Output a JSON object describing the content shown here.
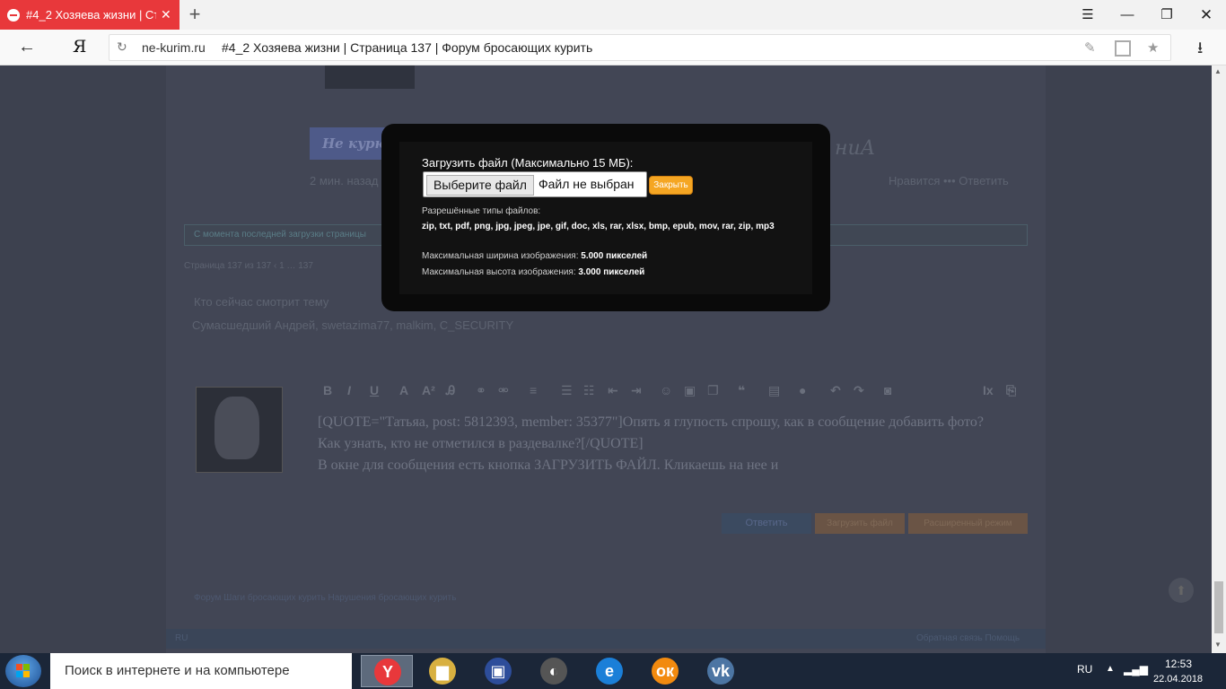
{
  "browser": {
    "tab_title": "#4_2 Хозяева жизни | Стр",
    "tab_close": "✕",
    "new_tab": "+",
    "menu_icon": "☰",
    "minimize": "—",
    "maximize": "❐",
    "close": "✕",
    "back": "←",
    "logo": "Я",
    "reload": "↻",
    "url_domain": "ne-kurim.ru",
    "url_title": "#4_2 Хозяева жизни | Страница 137 | Форум бросающих курить",
    "bookmark": "★",
    "download": "⭳",
    "addon": "✎"
  },
  "page": {
    "signature_banner": "Не курю",
    "signature_tail": "ниА",
    "post_meta": "2 мин. назад",
    "post_actions": "Нравится  •••  Ответить",
    "notice": "С момента последней загрузки страницы",
    "pagination": "Страница 137 из 137   ‹   1   …   137",
    "viewers_title": "Кто сейчас смотрит тему",
    "viewers": "Сумасшедший Андрей, swetazima77, malkim, C_SECURITY",
    "editor_line1": "[QUOTE=\"Татьяа, post: 5812393, member: 35377\"]Опять я глупость спрошу, как в сообщение добавить фото?",
    "editor_line2": "Как узнать, кто не отметился в раздевалке?[/QUOTE]",
    "editor_line3": "В окне для сообщения есть кнопка ЗАГРУЗИТЬ ФАЙЛ. Кликаешь на нее и",
    "btn_reply": "Ответить",
    "btn_upload": "Загрузить файл",
    "btn_extended": "Расширенный режим",
    "breadcrumb": "Форум     Шаги бросающих курить     Нарушения бросающих курить",
    "footer_left": "RU",
    "footer_right": "Обратная связь   Помощь",
    "scroll_top": "⬆"
  },
  "modal": {
    "title": "Загрузить файл (Максимально 15 МБ):",
    "choose_file": "Выберите файл",
    "file_status": "Файл не выбран",
    "close_button": "Закрыть",
    "types_label": "Разрешённые типы файлов:",
    "types_value": "zip, txt, pdf, png, jpg, jpeg, jpe, gif, doc, xls, rar, xlsx, bmp, epub, mov, rar, zip, mp3",
    "max_width_label": "Максимальная ширина изображения:",
    "max_width_value": "5.000 пикселей",
    "max_height_label": "Максимальная высота изображения:",
    "max_height_value": "3.000 пикселей"
  },
  "taskbar": {
    "search_placeholder": "Поиск в интернете и на компьютере",
    "apps": [
      {
        "name": "yandex-browser",
        "glyph": "Y",
        "color": "#e8383b"
      },
      {
        "name": "explorer",
        "glyph": "▆",
        "color": "#d8b040"
      },
      {
        "name": "save-app",
        "glyph": "▣",
        "color": "#2d4d9a"
      },
      {
        "name": "media-app",
        "glyph": "◐",
        "color": "#555555"
      },
      {
        "name": "internet-explorer",
        "glyph": "e",
        "color": "#1b7fd8"
      },
      {
        "name": "odnoklassniki",
        "glyph": "ок",
        "color": "#f28a0f"
      },
      {
        "name": "vkontakte",
        "glyph": "vk",
        "color": "#4c75a3"
      }
    ],
    "lang": "RU",
    "time": "12:53",
    "date": "22.04.2018"
  }
}
